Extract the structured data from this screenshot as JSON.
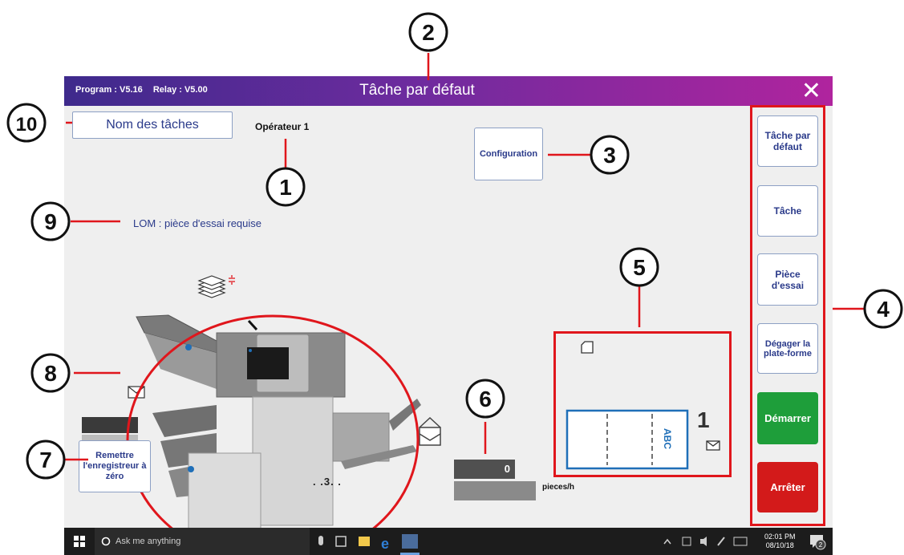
{
  "window": {
    "program_version": "Program : V5.16",
    "relay_version": "Relay : V5.00",
    "title": "Tâche par défaut",
    "close_glyph": "✕"
  },
  "main": {
    "task_names_button": "Nom des tâches",
    "operator": "Opérateur 1",
    "configuration_button": "Configuration",
    "lom_message": "LOM : pièce d'essai requise",
    "reset_counter_button": "Remettre l'enregistreur à zéro",
    "counter_value": "0",
    "rate_unit": "pieces/h",
    "page_count_label": ". .3. ."
  },
  "preview": {
    "envelope_count": "1",
    "address_text": "ABC"
  },
  "side_panel": {
    "default_task": "Tâche par défaut",
    "task": "Tâche",
    "test_piece": "Pièce d'essai",
    "clear_deck": "Dégager la plate-forme",
    "start": "Démarrer",
    "stop": "Arrêter"
  },
  "annotations": [
    "1",
    "2",
    "3",
    "4",
    "5",
    "6",
    "7",
    "8",
    "9",
    "10"
  ],
  "taskbar": {
    "search_placeholder": "Ask me anything",
    "time": "02:01 PM",
    "date": "08/10/18",
    "notification_count": "2"
  },
  "colors": {
    "title_gradient_start": "#3e2a8c",
    "title_gradient_end": "#b0249e",
    "start_green": "#1e9e3a",
    "stop_red": "#d31a1a",
    "annotation_red": "#e0161c",
    "link_blue": "#2a3a8a"
  }
}
